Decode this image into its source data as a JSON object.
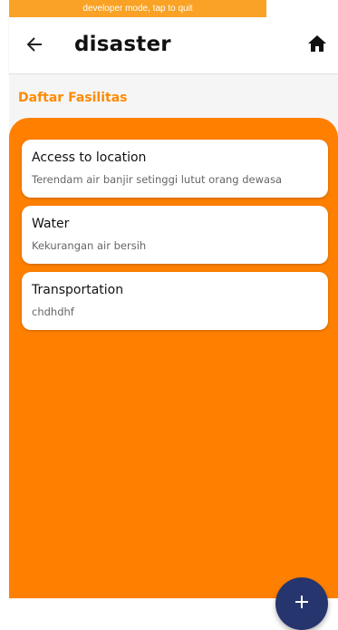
{
  "dev_banner": {
    "text": "developer mode, tap to quit"
  },
  "appbar": {
    "back_icon": "arrow-left-icon",
    "title": "disaster",
    "home_icon": "home-icon"
  },
  "section": {
    "title": "Daftar Fasilitas"
  },
  "facilities": [
    {
      "title": "Access to location",
      "subtitle": "Terendam air banjir setinggi lutut orang dewasa"
    },
    {
      "title": "Water",
      "subtitle": "Kekurangan air bersih"
    },
    {
      "title": "Transportation",
      "subtitle": "chdhdhf"
    }
  ],
  "fab": {
    "icon": "plus-icon"
  },
  "colors": {
    "accent": "#ff8000",
    "section_title": "#ff8a00",
    "dev_banner": "#f9a225",
    "fab": "#26356e"
  }
}
